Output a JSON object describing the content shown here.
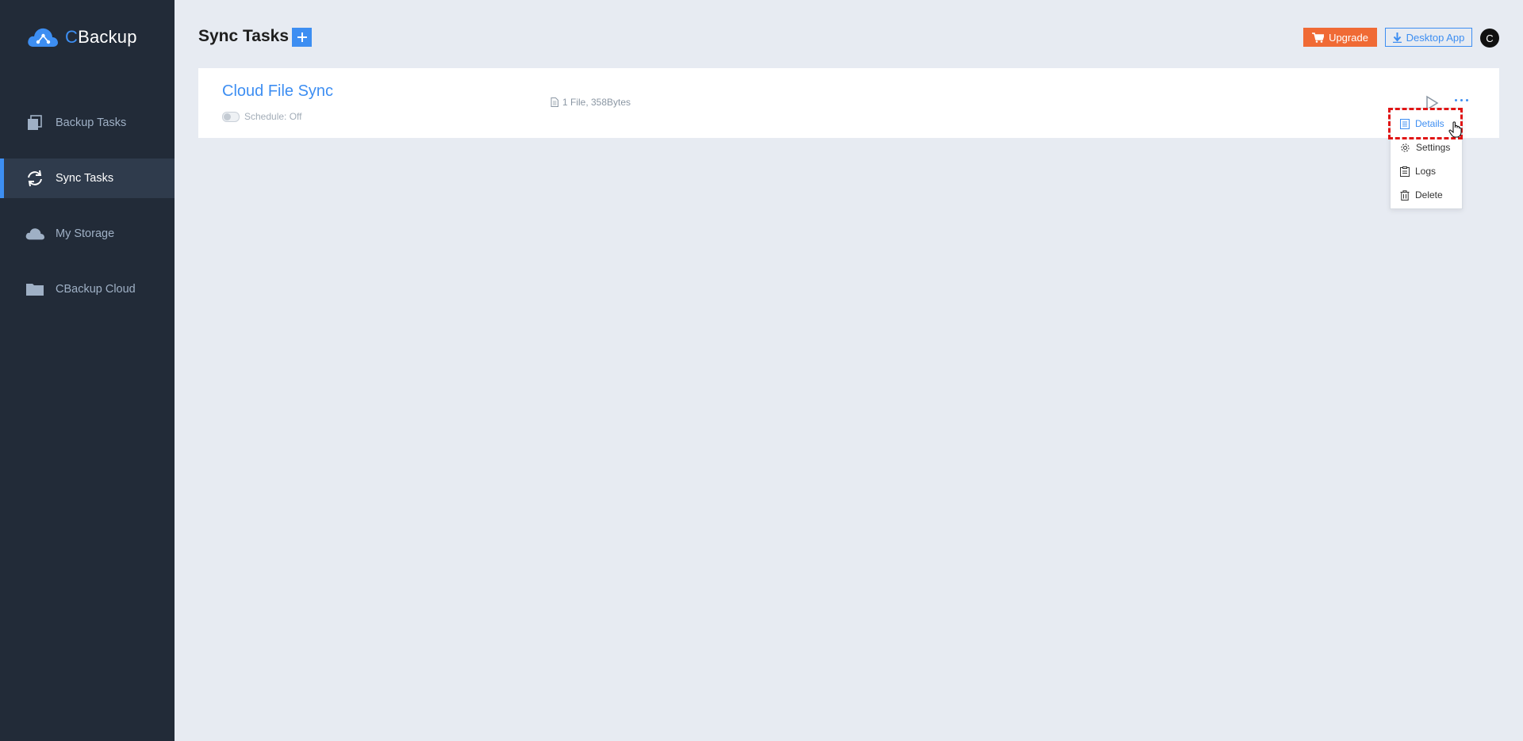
{
  "app": {
    "logo_c": "C",
    "logo_rest": "Backup"
  },
  "sidebar": {
    "items": [
      {
        "label": "Backup Tasks",
        "icon": "backup-tasks-icon",
        "active": false
      },
      {
        "label": "Sync Tasks",
        "icon": "sync-icon",
        "active": true
      },
      {
        "label": "My Storage",
        "icon": "cloud-icon",
        "active": false
      },
      {
        "label": "CBackup Cloud",
        "icon": "folder-icon",
        "active": false
      }
    ]
  },
  "header": {
    "title": "Sync Tasks",
    "add_label": "+",
    "upgrade_label": "Upgrade",
    "desktop_label": "Desktop App",
    "avatar_letter": "C"
  },
  "task": {
    "name": "Cloud File Sync",
    "schedule": "Schedule: Off",
    "file_info": "1 File, 358Bytes"
  },
  "menu": {
    "items": [
      {
        "label": "Details",
        "icon": "document-icon"
      },
      {
        "label": "Settings",
        "icon": "gear-icon"
      },
      {
        "label": "Logs",
        "icon": "clipboard-icon"
      },
      {
        "label": "Delete",
        "icon": "trash-icon"
      }
    ]
  },
  "colors": {
    "accent": "#3d8ef2",
    "sidebar_bg": "#222b38",
    "upgrade": "#f06a35",
    "highlight": "#e01515"
  }
}
